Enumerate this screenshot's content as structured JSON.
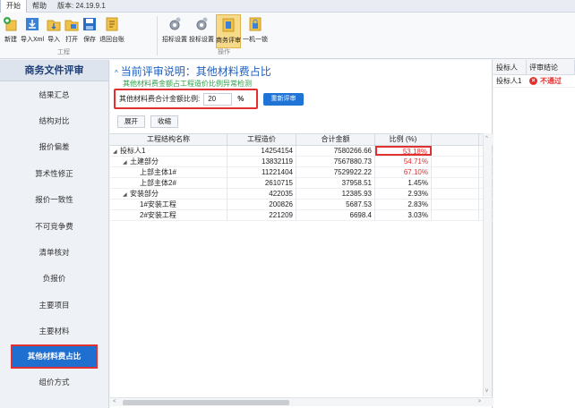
{
  "menubar": {
    "items": [
      "开始",
      "帮助",
      "版本: 24.19.9.1"
    ]
  },
  "ribbon": {
    "group1": {
      "name": "工程",
      "buttons": [
        "新建",
        "导入Xml",
        "导入",
        "打开",
        "保存",
        "退回台账"
      ]
    },
    "group2": {
      "name": "操作",
      "buttons": [
        "招标设置",
        "投标设置",
        "商务评审",
        "一机一锁"
      ]
    }
  },
  "sidebar": {
    "title": "商务文件评审",
    "items": [
      "结果汇总",
      "结构对比",
      "报价偏差",
      "算术性修正",
      "报价一致性",
      "不可竞争费",
      "清单核对",
      "负报价",
      "主要项目",
      "主要材料",
      "其他材料费占比",
      "组价方式"
    ],
    "active": "其他材料费占比"
  },
  "main": {
    "heading": "当前评审说明：其他材料费占比",
    "subheading": "其他材料费金额占工程造价比例异常检测",
    "ratio_label": "其他材料费合计金额比例:",
    "ratio_value": "20",
    "ratio_unit": "%",
    "reevaluate_label": "重新评审",
    "expand_label": "展开",
    "collapse_label": "收缩"
  },
  "table": {
    "columns": [
      "工程结构名称",
      "工程造价",
      "合计金额",
      "比例 (%)"
    ],
    "rows": [
      {
        "name": "投标人1",
        "indent": 0,
        "toggle": "◢",
        "cost": "14254154",
        "total": "7580266.66",
        "ratio": "53.18%",
        "red": true,
        "highlight": true
      },
      {
        "name": "土建部分",
        "indent": 1,
        "toggle": "◢",
        "cost": "13832119",
        "total": "7567880.73",
        "ratio": "54.71%",
        "red": true,
        "highlight": false
      },
      {
        "name": "上部主体1#",
        "indent": 2,
        "toggle": "",
        "cost": "11221404",
        "total": "7529922.22",
        "ratio": "67.10%",
        "red": true,
        "highlight": false
      },
      {
        "name": "上部主体2#",
        "indent": 2,
        "toggle": "",
        "cost": "2610715",
        "total": "37958.51",
        "ratio": "1.45%",
        "red": false,
        "highlight": false
      },
      {
        "name": "安装部分",
        "indent": 1,
        "toggle": "◢",
        "cost": "422035",
        "total": "12385.93",
        "ratio": "2.93%",
        "red": false,
        "highlight": false
      },
      {
        "name": "1#安装工程",
        "indent": 2,
        "toggle": "",
        "cost": "200826",
        "total": "5687.53",
        "ratio": "2.83%",
        "red": false,
        "highlight": false
      },
      {
        "name": "2#安装工程",
        "indent": 2,
        "toggle": "",
        "cost": "221209",
        "total": "6698.4",
        "ratio": "3.03%",
        "red": false,
        "highlight": false
      }
    ]
  },
  "right_panel": {
    "columns": [
      "投标人",
      "评审结论"
    ],
    "rows": [
      {
        "bidder": "投标人1",
        "result": "不通过"
      }
    ]
  },
  "colors": {
    "accent": "#1f74d6",
    "alert": "#e03030",
    "subtitle": "#2e9e4a"
  }
}
